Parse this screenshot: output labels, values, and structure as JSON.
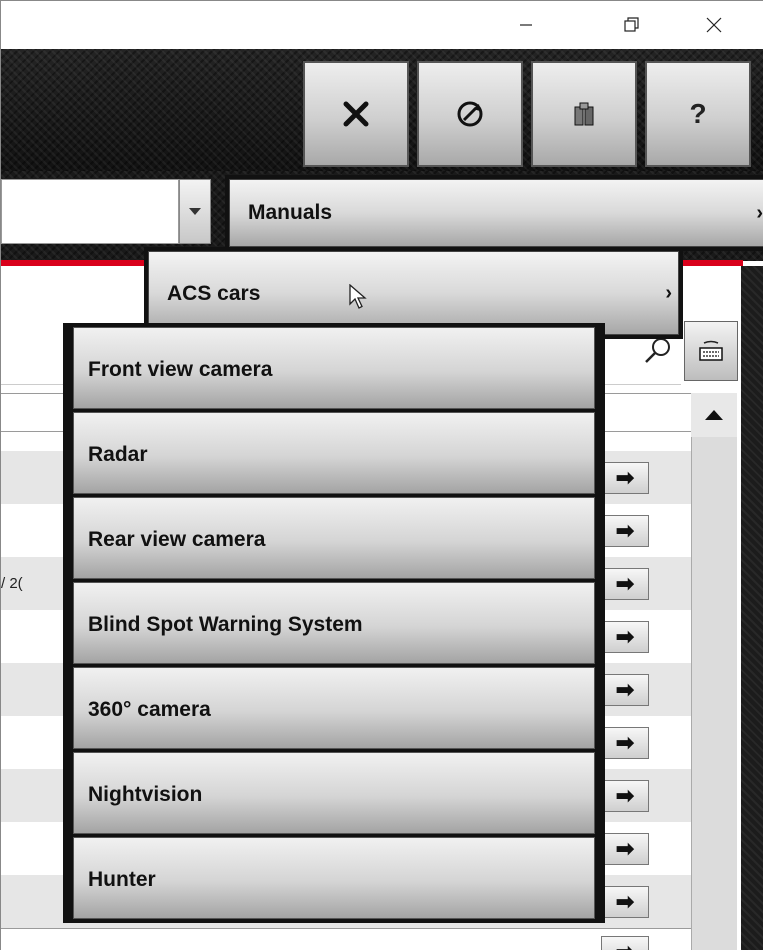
{
  "window": {
    "minimize_icon": "minimize-icon",
    "maximize_icon": "restore-icon",
    "close_icon": "close-icon"
  },
  "toolbar": {
    "buttons": [
      {
        "name": "tools-button",
        "icon": "wrench-screwdriver-icon"
      },
      {
        "name": "sync-button",
        "icon": "sync-icon"
      },
      {
        "name": "gifts-button",
        "icon": "gifts-icon"
      },
      {
        "name": "help-button",
        "label": "?"
      }
    ]
  },
  "menu": {
    "level1": {
      "label": "Manuals",
      "chevron": "›"
    },
    "level2": {
      "label": "ACS cars",
      "chevron": "›"
    },
    "level3": {
      "items": [
        "Front view camera",
        "Radar",
        "Rear view camera",
        "Blind Spot Warning System",
        "360° camera",
        "Nightvision",
        "Hunter"
      ]
    }
  },
  "list": {
    "partial_text": "/ 2(",
    "arrow_glyph": "➡"
  },
  "colors": {
    "accent_red": "#d9001b",
    "header_dark": "#1a1a1a"
  }
}
